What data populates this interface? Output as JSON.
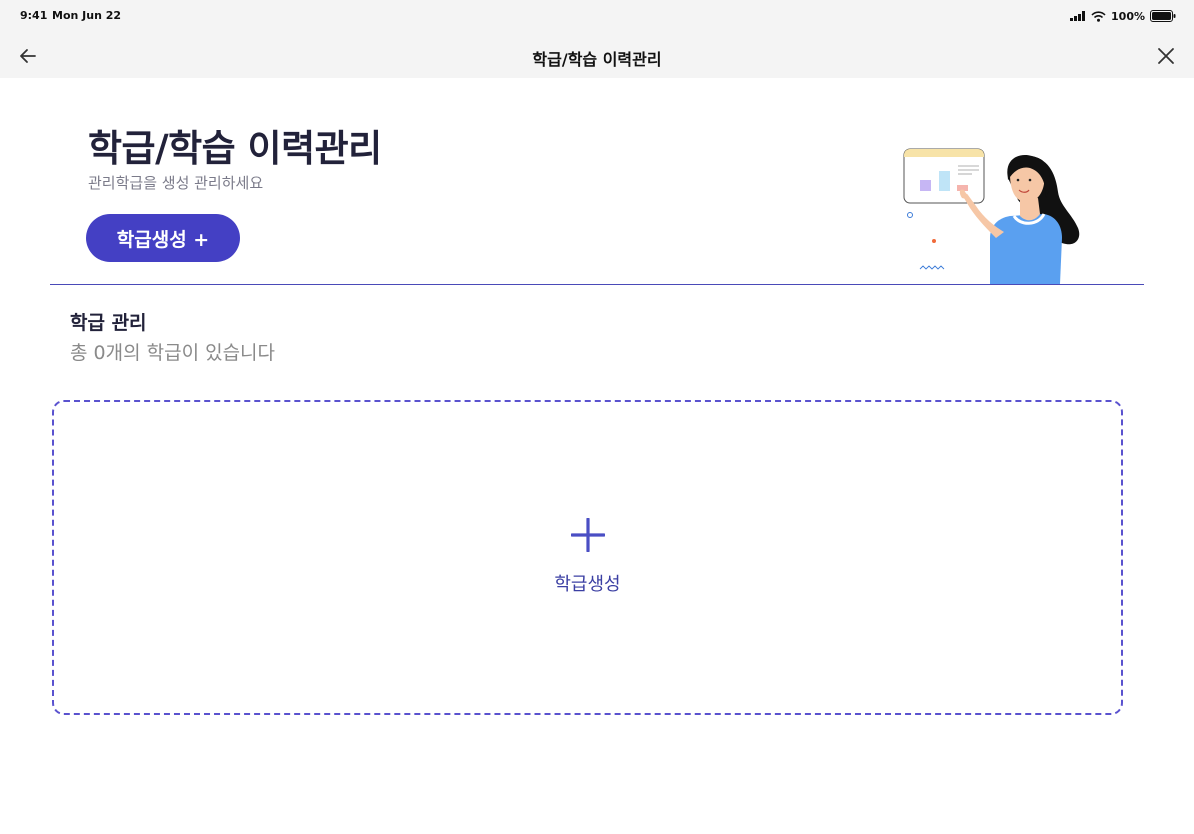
{
  "status_bar": {
    "time": "9:41",
    "date": "Mon Jun 22",
    "battery": "100%",
    "icons": [
      "cellular-signal-icon",
      "wifi-icon",
      "battery-icon"
    ]
  },
  "nav": {
    "title": "학급/학습 이력관리",
    "back_icon": "arrow-left-icon",
    "close_icon": "close-icon"
  },
  "hero": {
    "title": "학급/학습 이력관리",
    "subtitle": "관리학급을 생성 관리하세요",
    "create_button_label": "학급생성 +"
  },
  "section": {
    "title": "학급 관리",
    "count_text": "총 0개의 학급이 있습니다"
  },
  "create_card": {
    "label": "학급생성",
    "icon": "plus-icon"
  },
  "colors": {
    "accent": "#4440c4",
    "card_border": "#5a52cf",
    "title_text": "#22223a",
    "nav_background": "#f4f4f4"
  }
}
